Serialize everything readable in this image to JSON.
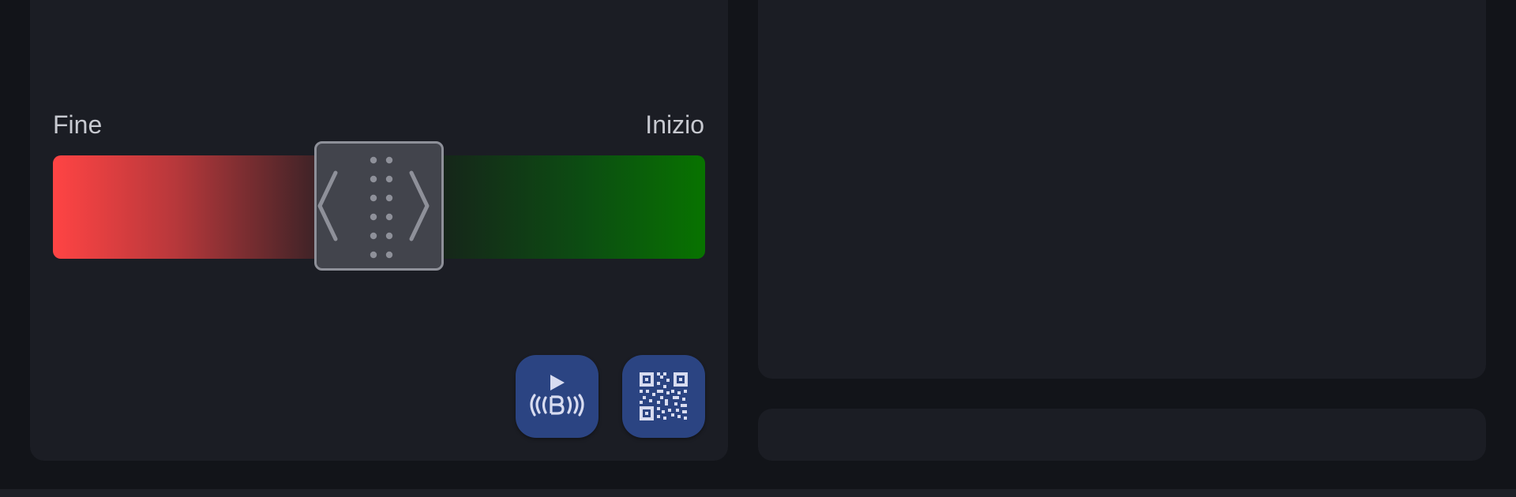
{
  "slider": {
    "left_label": "Fine",
    "right_label": "Inizio",
    "handle_position": 0.5,
    "colors": {
      "left_end": "#ff4444",
      "right_end": "#087300",
      "handle": "#42444c"
    }
  },
  "actions": [
    {
      "icon": "play-broadcast-icon",
      "name": "broadcast-button"
    },
    {
      "icon": "qr-code-icon",
      "name": "qr-code-button"
    }
  ],
  "theme": {
    "background": "#121419",
    "card": "#1b1d24",
    "accent": "#2b4482"
  }
}
